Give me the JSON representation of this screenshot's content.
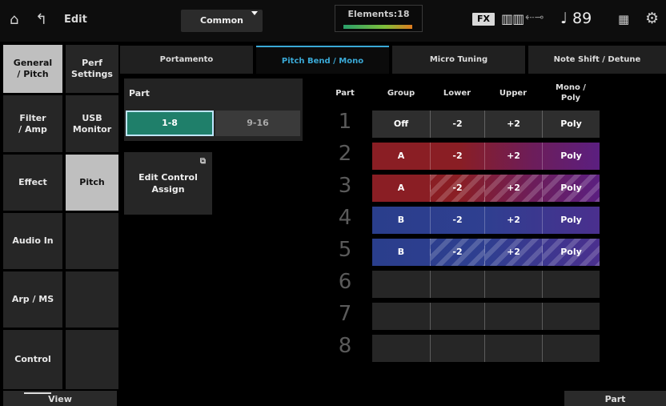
{
  "topbar": {
    "home_icon": "home-icon",
    "back_icon": "back-arrow-icon",
    "mode": "Edit",
    "target": "Common",
    "elements": "Elements:18",
    "fx": "FX",
    "keyboard_icon": "keyboard-icon",
    "usb_icon": "usb-icon",
    "tempo": "♩ 89",
    "grid_icon": "grid-icon",
    "gear_icon": "gear-icon"
  },
  "left_tabs": [
    "General\n/ Pitch",
    "Filter\n/ Amp",
    "Effect",
    "Audio In",
    "Arp / MS",
    "Control"
  ],
  "mid_tabs": [
    "Perf\nSettings",
    "USB\nMonitor",
    "Pitch",
    "",
    "",
    ""
  ],
  "sub_tabs": [
    "Portamento",
    "Pitch Bend / Mono",
    "Micro Tuning",
    "Note Shift / Detune"
  ],
  "part_panel": {
    "label": "Part",
    "btn_1_8": "1-8",
    "btn_9_16": "9-16"
  },
  "edit_control_assign": "Edit Control\nAssign",
  "table": {
    "headers": {
      "part": "Part",
      "group": "Group",
      "lower": "Lower",
      "upper": "Upper",
      "mono_poly": "Mono /\nPoly"
    },
    "rows": [
      {
        "num": "1",
        "group": "Off",
        "lower": "-2",
        "upper": "+2",
        "mode": "Poly"
      },
      {
        "num": "2",
        "group": "A",
        "lower": "-2",
        "upper": "+2",
        "mode": "Poly"
      },
      {
        "num": "3",
        "group": "A",
        "lower": "-2",
        "upper": "+2",
        "mode": "Poly"
      },
      {
        "num": "4",
        "group": "B",
        "lower": "-2",
        "upper": "+2",
        "mode": "Poly"
      },
      {
        "num": "5",
        "group": "B",
        "lower": "-2",
        "upper": "+2",
        "mode": "Poly"
      },
      {
        "num": "6",
        "group": "",
        "lower": "",
        "upper": "",
        "mode": ""
      },
      {
        "num": "7",
        "group": "",
        "lower": "",
        "upper": "",
        "mode": ""
      },
      {
        "num": "8",
        "group": "",
        "lower": "",
        "upper": "",
        "mode": ""
      }
    ]
  },
  "bottom": {
    "view": "View",
    "part": "Part"
  }
}
